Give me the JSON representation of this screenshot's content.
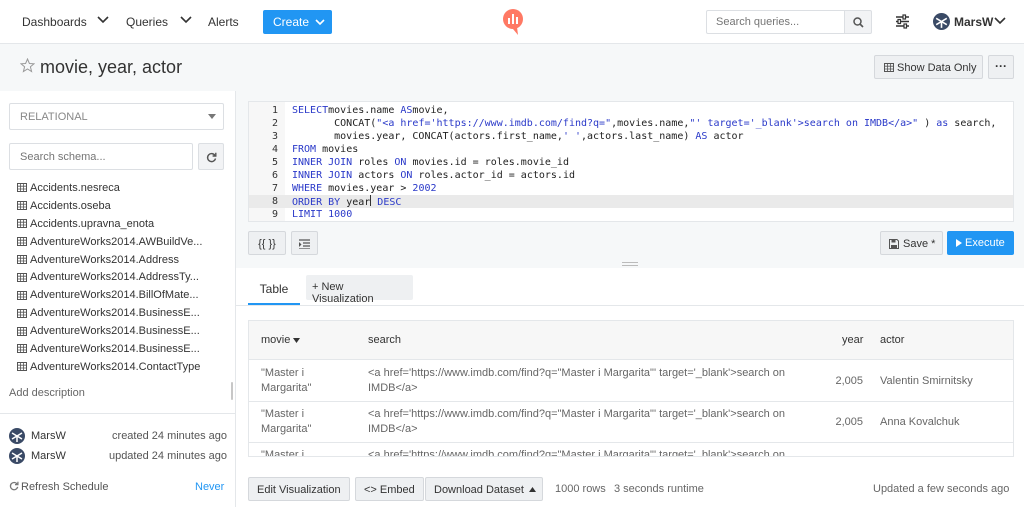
{
  "nav": {
    "dashboards": "Dashboards",
    "queries": "Queries",
    "alerts": "Alerts",
    "create": "Create",
    "search_placeholder": "Search queries...",
    "user": "MarsW"
  },
  "query": {
    "title": "movie, year, actor",
    "show_data_only": "Show Data Only",
    "more": "···"
  },
  "sidebar": {
    "datasource": "RELATIONAL",
    "schema_search_placeholder": "Search schema...",
    "schema": [
      "Accidents.nesreca",
      "Accidents.oseba",
      "Accidents.upravna_enota",
      "AdventureWorks2014.AWBuildVe...",
      "AdventureWorks2014.Address",
      "AdventureWorks2014.AddressTy...",
      "AdventureWorks2014.BillOfMate...",
      "AdventureWorks2014.BusinessE...",
      "AdventureWorks2014.BusinessE...",
      "AdventureWorks2014.BusinessE...",
      "AdventureWorks2014.ContactType"
    ],
    "add_description": "Add description",
    "created_by": "MarsW",
    "created_text": "created 24 minutes ago",
    "updated_by": "MarsW",
    "updated_text": "updated 24 minutes ago",
    "refresh_schedule": "Refresh Schedule",
    "refresh_value": "Never"
  },
  "editor": {
    "line_numbers": [
      "1",
      "2",
      "3",
      "4",
      "5",
      "6",
      "7",
      "8",
      "9"
    ],
    "lines": [
      [
        [
          "kw",
          "SELECT"
        ],
        [
          "",
          "movies.name "
        ],
        [
          "kw",
          "AS"
        ],
        [
          "",
          "movie,"
        ]
      ],
      [
        [
          "",
          "       CONCAT("
        ],
        [
          "str",
          "\"<a href='https://www.imdb.com/find?q=\""
        ],
        [
          "",
          ",movies.name,"
        ],
        [
          "str",
          "\"' target='_blank'>search on IMDB</a>\""
        ],
        [
          "",
          " ) "
        ],
        [
          "kw",
          "as"
        ],
        [
          "",
          " search,"
        ]
      ],
      [
        [
          "",
          "       movies.year, CONCAT(actors.first_name,"
        ],
        [
          "str",
          "' '"
        ],
        [
          "",
          ",actors.last_name) "
        ],
        [
          "kw",
          "AS"
        ],
        [
          "",
          " actor"
        ]
      ],
      [
        [
          "kw",
          "FROM"
        ],
        [
          "",
          " movies"
        ]
      ],
      [
        [
          "kw",
          "INNER JOIN"
        ],
        [
          "",
          " roles "
        ],
        [
          "kw",
          "ON"
        ],
        [
          "",
          " movies.id = roles.movie_id"
        ]
      ],
      [
        [
          "kw",
          "INNER JOIN"
        ],
        [
          "",
          " actors "
        ],
        [
          "kw",
          "ON"
        ],
        [
          "",
          " roles.actor_id = actors.id"
        ]
      ],
      [
        [
          "kw",
          "WHERE"
        ],
        [
          "",
          " movies.year > "
        ],
        [
          "kw",
          "2002"
        ]
      ],
      [
        [
          "kw",
          "ORDER BY"
        ],
        [
          "",
          " year"
        ],
        [
          "cursor",
          ""
        ],
        [
          "kw",
          " DESC"
        ]
      ],
      [
        [
          "kw",
          "LIMIT"
        ],
        [
          "",
          " "
        ],
        [
          "kw",
          "1000"
        ]
      ]
    ],
    "format_label": "{{ }}",
    "save_label": "Save *",
    "execute_label": "Execute"
  },
  "results": {
    "tab_table": "Table",
    "tab_new_vis": "+ New Visualization",
    "columns": {
      "movie": "movie",
      "search": "search",
      "year": "year",
      "actor": "actor"
    },
    "rows": [
      {
        "movie": "\"Master i Margarita\"",
        "search": "<a href='https://www.imdb.com/find?q=\"Master i Margarita\"' target='_blank'>search on IMDB</a>",
        "year": "2,005",
        "actor": "Valentin Smirnitsky"
      },
      {
        "movie": "\"Master i Margarita\"",
        "search": "<a href='https://www.imdb.com/find?q=\"Master i Margarita\"' target='_blank'>search on IMDB</a>",
        "year": "2,005",
        "actor": "Anna Kovalchuk"
      },
      {
        "movie": "\"Master i Margarita\"",
        "search": "<a href='https://www.imdb.com/find?q=\"Master i Margarita\"' target='_blank'>search on IMDB</a>",
        "year": "",
        "actor": ""
      }
    ]
  },
  "footer": {
    "edit_visualization": "Edit Visualization",
    "embed": "<> Embed",
    "download_dataset": "Download Dataset",
    "rows": "1000 rows",
    "runtime": "3 seconds runtime",
    "updated": "Updated a few seconds ago"
  }
}
